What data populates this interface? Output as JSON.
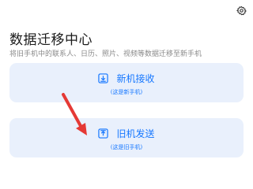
{
  "header": {
    "title": "数据迁移中心",
    "subtitle": "将旧手机中的联系人、日历、照片、视频等数据迁移至新手机",
    "settings_icon": "gear-icon"
  },
  "cards": {
    "receive": {
      "label": "新机接收",
      "note": "(这是新手机)",
      "icon": "download-icon"
    },
    "send": {
      "label": "旧机发送",
      "note": "(这是旧手机)",
      "icon": "upload-icon"
    }
  },
  "annotation": {
    "icon": "red-arrow-pointer",
    "color": "#e53935"
  },
  "colors": {
    "accent": "#1677ff",
    "card_background": "#e9f0fc",
    "title": "#1a1a1a",
    "subtitle": "#8a8a8a"
  }
}
